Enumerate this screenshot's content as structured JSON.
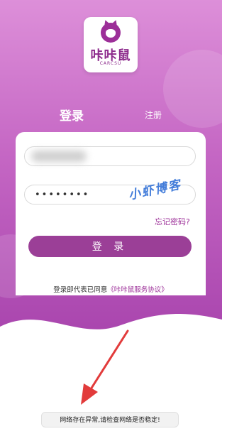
{
  "logo": {
    "brand_cn": "咔咔鼠",
    "brand_en": "CARCSU"
  },
  "tabs": {
    "login": "登录",
    "register": "注册"
  },
  "form": {
    "username_value": "",
    "password_value": "••••••••",
    "forgot_label": "忘记密码?",
    "login_button": "登 录"
  },
  "agreement": {
    "prefix": "登录即代表已同意",
    "link": "《咔咔鼠服务协议》"
  },
  "watermark": "小虾博客",
  "toast": "网络存在异常,请检查网络是否稳定!",
  "colors": {
    "brand": "#9b3f97",
    "gradient_top": "#dd8fd9",
    "gradient_bottom": "#a844ad",
    "arrow": "#e23b3b"
  },
  "icons": {
    "logo": "mouse-logo-icon",
    "annotation": "red-arrow"
  }
}
